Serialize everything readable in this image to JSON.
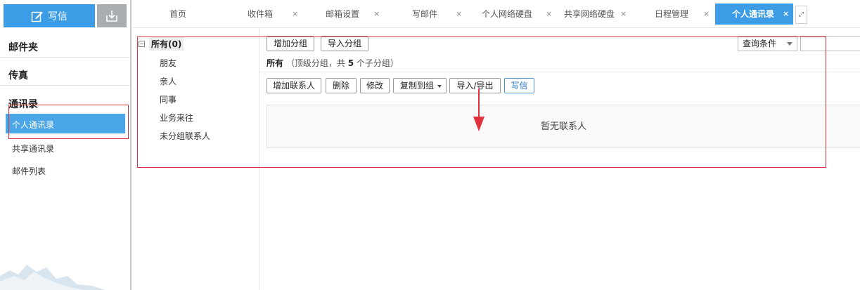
{
  "sidebar": {
    "compose_label": "写信",
    "sections": [
      "邮件夹",
      "传真",
      "通讯录"
    ],
    "items": [
      {
        "label": "个人通讯录",
        "active": true
      },
      {
        "label": "共享通讯录",
        "active": false
      },
      {
        "label": "邮件列表",
        "active": false
      }
    ]
  },
  "tabs": [
    {
      "label": "首页"
    },
    {
      "label": "收件箱",
      "close": "×"
    },
    {
      "label": "邮箱设置",
      "close": "×"
    },
    {
      "label": "写邮件",
      "close": "×"
    },
    {
      "label": "个人网络硬盘",
      "close": "×"
    },
    {
      "label": "共享网络硬盘",
      "close": "×"
    },
    {
      "label": "日程管理",
      "close": "×"
    },
    {
      "label": "个人通讯录",
      "close": "×",
      "active": true
    }
  ],
  "tree": {
    "toggle": "⊟",
    "root": "所有(0)",
    "children": [
      "朋友",
      "亲人",
      "同事",
      "业务来往",
      "未分组联系人"
    ]
  },
  "group_toolbar": {
    "add_group": "增加分组",
    "import_group": "导入分组"
  },
  "query": {
    "select_value": "查询条件",
    "input_value": ""
  },
  "group_info": {
    "name": "所有",
    "detail_prefix": "（顶级分组，共",
    "count": "5",
    "detail_suffix": "个子分组）"
  },
  "contact_toolbar": {
    "add_contact": "增加联系人",
    "delete": "删除",
    "edit": "修改",
    "copy_to_group": "复制到组",
    "import_export": "导入/导出",
    "write": "写信"
  },
  "empty_message": "暂无联系人",
  "colors": {
    "accent": "#3d9ce6",
    "annotation": "#e0323c"
  }
}
